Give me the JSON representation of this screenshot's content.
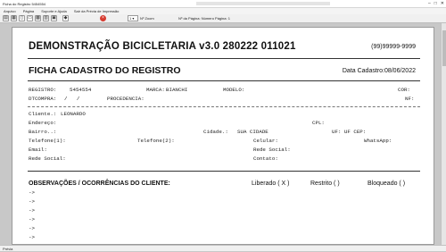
{
  "window": {
    "title": "Ficha do Registro 5454554"
  },
  "menu": [
    "Arquivo",
    "Página",
    "Suporte e Ajuda",
    "Sair da Prévia de Impressão"
  ],
  "toolbar": {
    "page_value": "1",
    "zoom_label": "Nº Zoom",
    "pages_label": "Nº da Página: Número Página: 1"
  },
  "status": "Prévia",
  "report": {
    "title": "DEMONSTRAÇÃO BICICLETARIA v3.0 280222 011021",
    "phone": "(99)99999-9999",
    "subtitle": "FICHA CADASTRO DO REGISTRO",
    "date": "Data Cadastro:08/06/2022",
    "row1": {
      "registro_label": "REGISTRO:",
      "registro_value": "5454554",
      "marca_label": "MARCA:",
      "marca_value": "BIANCHI",
      "modelo_label": "MODELO:",
      "cor_label": "COR:"
    },
    "row2": {
      "dtcompra_label": "DTCOMPRA:",
      "dtcompra_value": "/   /",
      "procedencia_label": "PROCEDENCIA:",
      "nf_label": "NF:"
    },
    "client": {
      "cliente_label": "Cliente.:",
      "cliente_value": "LEONARDO",
      "endereco_label": "Endereço:",
      "cpl_label": "CPL:",
      "bairro_label": "Bairro..:",
      "cidade_label": "Cidade.:",
      "cidade_value": "SUA CIDADE",
      "uf_label": "UF: UF CEP:",
      "tel1_label": "Telefone(1):",
      "tel2_label": "Telefone(2):",
      "celular_label": "Celular:",
      "whatsapp_label": "WhatsApp:",
      "email_label": "Email:",
      "redesocial1_label": "Rede Social:",
      "redesocial2_label": "Rede Social:",
      "contato_label": "Contato:"
    },
    "obs": {
      "title": "OBSERVAÇÕES / OCORRÊNCIAS DO CLIENTE:",
      "liberado": "Liberado ( X )",
      "restrito": "Restrito (  )",
      "bloqueado": "Bloqueado (  )",
      "lines": [
        "->",
        "->",
        "->",
        "->",
        "->",
        "->"
      ]
    }
  }
}
